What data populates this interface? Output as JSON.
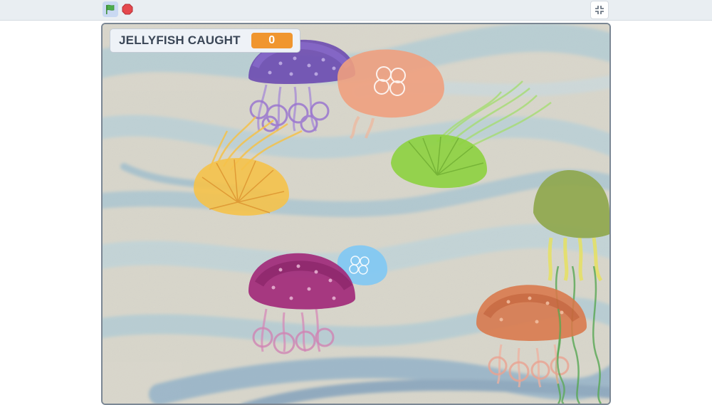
{
  "toolbar": {
    "green_flag_icon": "green-flag-icon",
    "stop_icon": "stop-sign-icon",
    "fullscreen_icon": "unfullscreen-icon"
  },
  "monitor": {
    "label": "JELLYFISH CAUGHT",
    "value": "0"
  },
  "colors": {
    "accent_orange": "#f0962f",
    "flag_green": "#4cae4c",
    "stop_red": "#e5484d"
  },
  "sprites": [
    {
      "name": "jellyfish-purple",
      "color": "#6d4bb0"
    },
    {
      "name": "jellyfish-peach",
      "color": "#f0a07e"
    },
    {
      "name": "jellyfish-green",
      "color": "#8dd23f"
    },
    {
      "name": "jellyfish-yellow",
      "color": "#f5c24a"
    },
    {
      "name": "jellyfish-magenta",
      "color": "#a22a7a"
    },
    {
      "name": "jellyfish-small-blue",
      "color": "#80c8f4"
    },
    {
      "name": "jellyfish-orange",
      "color": "#d9784a"
    },
    {
      "name": "jellyfish-olive",
      "color": "#8ea64a"
    }
  ]
}
